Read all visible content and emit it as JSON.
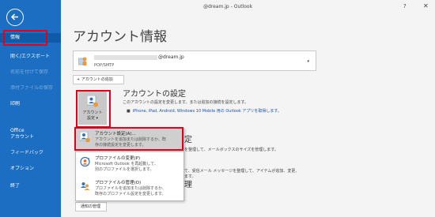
{
  "window": {
    "title": "@dream.jp  -  Outlook",
    "help": "?",
    "close": "✕"
  },
  "nav": {
    "items": [
      {
        "label": "情報",
        "state": "active"
      },
      {
        "label": "開く/エクスポート",
        "state": "normal"
      },
      {
        "label": "名前を付けて保存",
        "state": "disabled"
      },
      {
        "label": "添付ファイルの保存",
        "state": "disabled"
      },
      {
        "label": "印刷",
        "state": "normal"
      },
      {
        "label": "Office",
        "state": "normal"
      },
      {
        "label": "アカウント",
        "state": "normal"
      },
      {
        "label": "フィードバック",
        "state": "normal"
      },
      {
        "label": "オプション",
        "state": "normal"
      },
      {
        "label": "終了",
        "state": "normal"
      }
    ]
  },
  "main": {
    "title": "アカウント情報",
    "account": {
      "email": "@dream.jp",
      "type": "POP/SMTP"
    },
    "add_account_label": "+ アカウントの追加",
    "settings_button": {
      "line1": "アカウント",
      "line2": "設定 ▾"
    },
    "settings": {
      "heading": "アカウントの設定",
      "description": "このアカウントの設定を変更します。または追加の接続を設定します。",
      "link_bullet": "■",
      "link": "iPhone, iPad, Android, Windows 10 Mobile 用の Outlook アプリを取得します。"
    },
    "section2": {
      "heading_fragment": "定",
      "description_fragment": "を整理して、メールボックスのサイズを管理します。"
    },
    "section3": {
      "description_fragment": "て、受信メール メッセージを整理して、アイテムが追加、変更、",
      "description_fragment2": "ます。",
      "heading_fragment": "理"
    },
    "rules_button_fragment": "通知の管理"
  },
  "menu": {
    "items": [
      {
        "title": "アカウント設定(A)...",
        "desc": [
          "アカウントを追加または削除するか、既",
          "存の接続設定を変更します。"
        ],
        "selected": true
      },
      {
        "title": "プロファイルの変更(P)",
        "desc": [
          "Microsoft Outlook を再起動して、",
          "別のプロファイルを選択します。"
        ],
        "selected": false
      },
      {
        "title": "プロファイルの管理(O)",
        "desc": [
          "プロファイルを追加または削除するか、",
          "既存のプロファイル設定を変更します。"
        ],
        "selected": false
      }
    ]
  },
  "colors": {
    "nav_bg": "#1b6ec2",
    "highlight_red": "#e0001b",
    "link_blue": "#1a55a6"
  }
}
